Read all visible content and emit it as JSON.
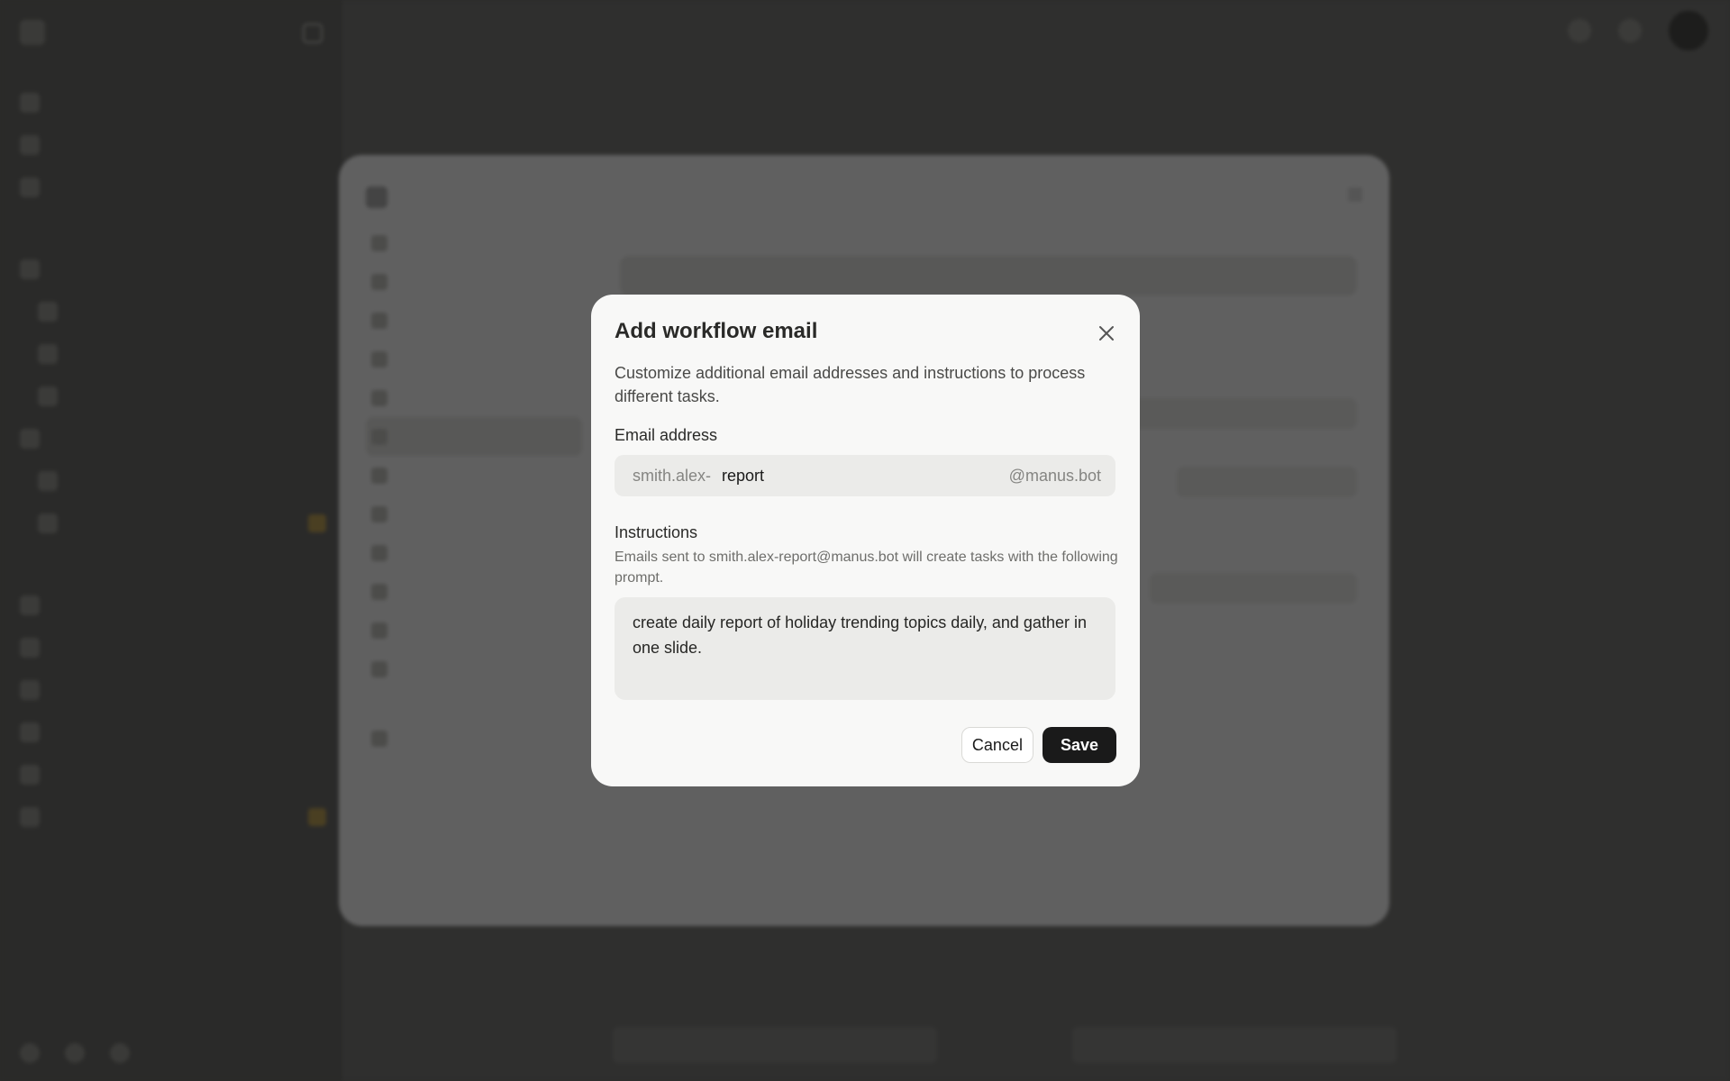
{
  "modal": {
    "title": "Add workflow email",
    "description": "Customize additional email addresses and instructions to process different tasks.",
    "email_label": "Email address",
    "email_prefix": "smith.alex-",
    "email_value": "report",
    "email_suffix": "@manus.bot",
    "instructions_label": "Instructions",
    "instructions_hint": "Emails sent to smith.alex-report@manus.bot will create tasks with the following prompt.",
    "instructions_value": "create daily report of holiday trending topics daily, and gather in one slide.",
    "cancel_label": "Cancel",
    "save_label": "Save",
    "close_icon": "close-icon"
  },
  "colors": {
    "save_bg": "#1a1a1a",
    "modal_bg": "#f8f8f7",
    "field_bg": "#ebebe9"
  }
}
